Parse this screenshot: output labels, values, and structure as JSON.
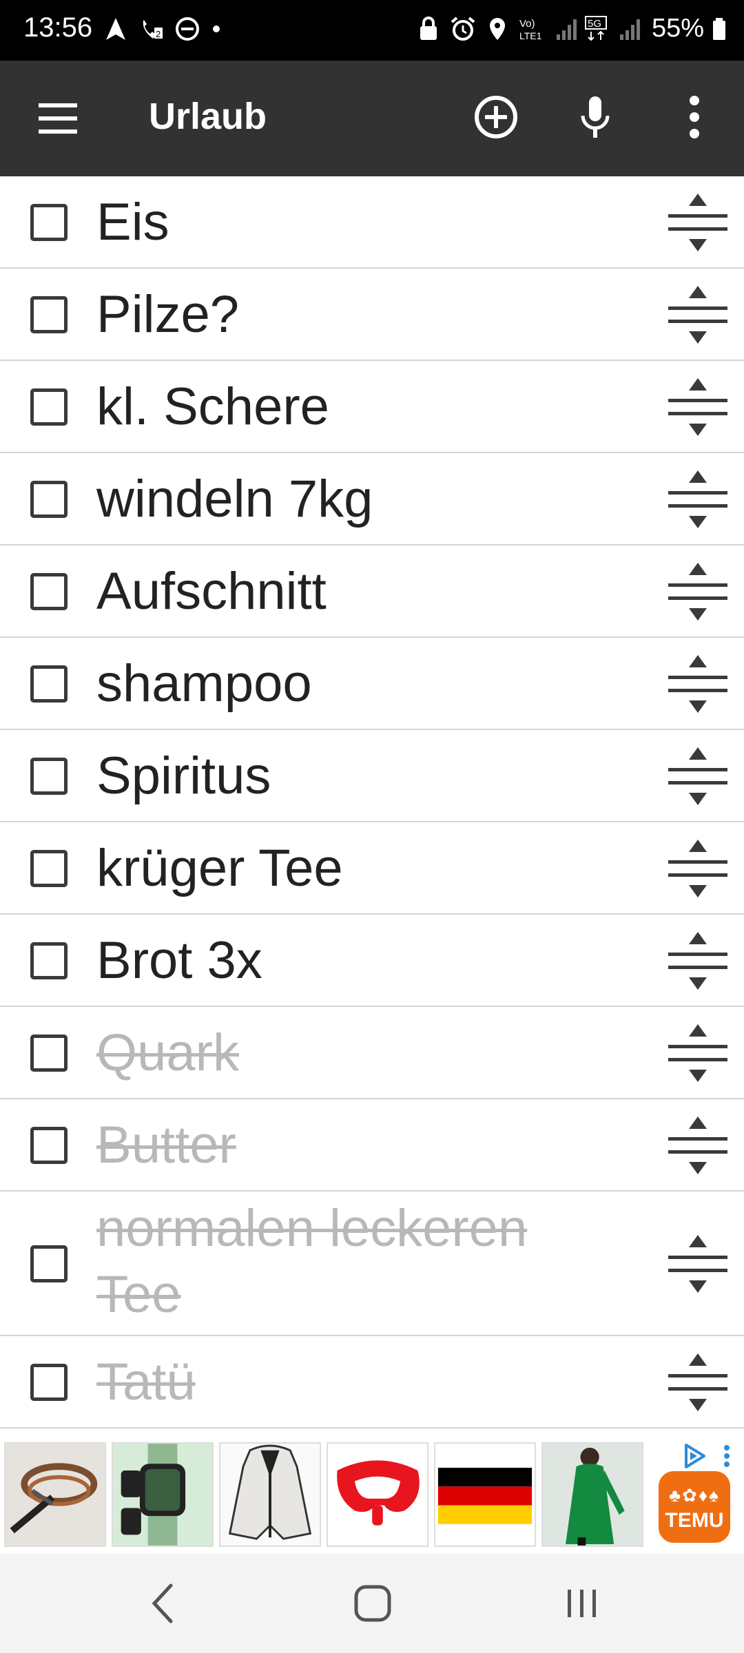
{
  "status_bar": {
    "time": "13:56",
    "battery": "55%",
    "left_icons": [
      "navigation-icon",
      "call-forward-icon",
      "do-not-disturb-icon",
      "dot-icon"
    ],
    "right_icons": [
      "lock-icon",
      "alarm-icon",
      "location-icon",
      "volte-icon",
      "signal-icon",
      "5g-icon",
      "signal-icon",
      "battery-icon"
    ]
  },
  "app_bar": {
    "title": "Urlaub",
    "icons": [
      "menu-icon",
      "add-circle-icon",
      "microphone-icon",
      "more-vert-icon"
    ]
  },
  "list": {
    "items": [
      {
        "label": "Eis",
        "done": false
      },
      {
        "label": "Pilze?",
        "done": false
      },
      {
        "label": "kl. Schere",
        "done": false
      },
      {
        "label": "windeln 7kg",
        "done": false
      },
      {
        "label": "Aufschnitt",
        "done": false
      },
      {
        "label": "shampoo",
        "done": false
      },
      {
        "label": "Spiritus",
        "done": false
      },
      {
        "label": "krüger Tee",
        "done": false
      },
      {
        "label": "Brot 3x",
        "done": false
      },
      {
        "label": "Quark",
        "done": true
      },
      {
        "label": "Butter",
        "done": true
      },
      {
        "label": "normalen leckeren Tee",
        "done": true
      },
      {
        "label": "Tatü",
        "done": true
      }
    ]
  },
  "ad_bar": {
    "products": [
      "tool-product",
      "smartwatch-product",
      "jacket-product",
      "vr-face-cushion-product",
      "german-flag-product",
      "green-dress-product"
    ],
    "brand": "TEMU"
  },
  "nav_bar": {
    "icons": [
      "back-icon",
      "home-icon",
      "recents-icon"
    ]
  }
}
